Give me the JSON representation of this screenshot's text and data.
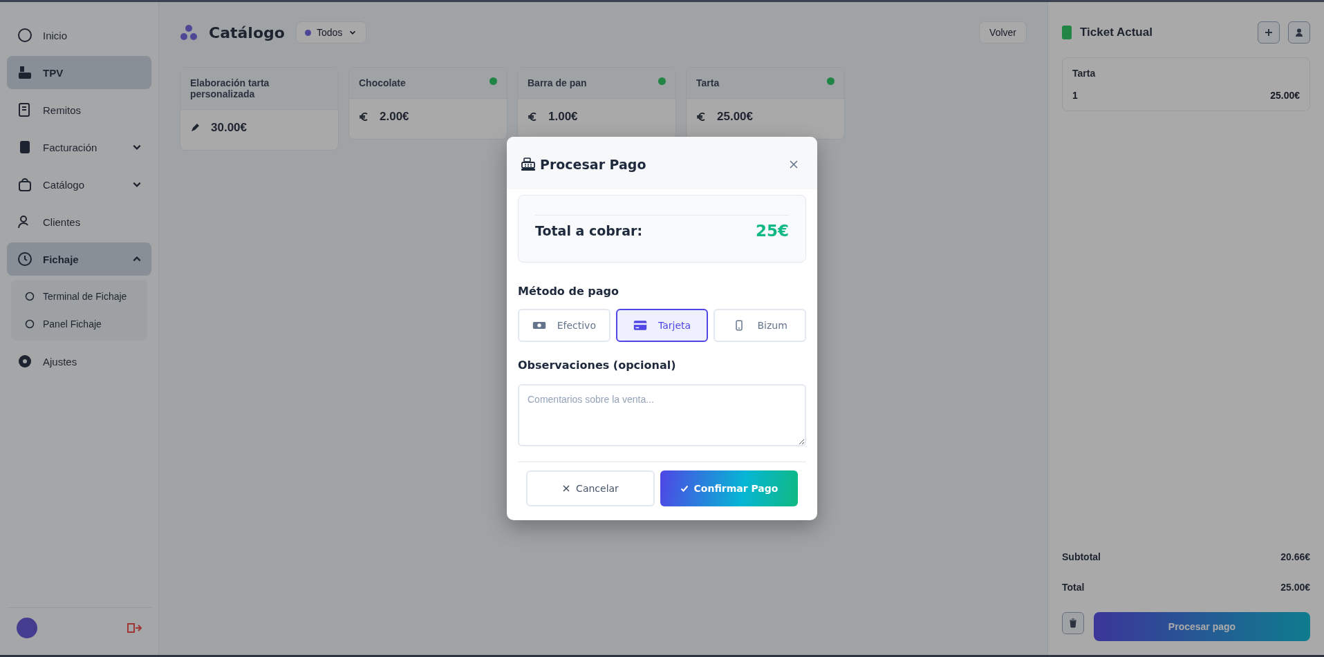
{
  "sidebar": {
    "items": [
      {
        "label": "Inicio",
        "kind": "link",
        "selected": false
      },
      {
        "label": "TPV",
        "kind": "link",
        "selected": true
      },
      {
        "label": "Remitos",
        "kind": "link",
        "selected": false
      },
      {
        "label": "Facturación",
        "kind": "group",
        "expanded": false,
        "selected": false
      },
      {
        "label": "Catálogo",
        "kind": "group",
        "expanded": false,
        "selected": false
      },
      {
        "label": "Clientes",
        "kind": "link",
        "selected": false
      },
      {
        "label": "Fichaje",
        "kind": "group",
        "expanded": true,
        "selected": true,
        "children": [
          {
            "label": "Terminal de Fichaje",
            "selected": false
          },
          {
            "label": "Panel Fichaje",
            "selected": false
          }
        ]
      },
      {
        "label": "Ajustes",
        "kind": "link",
        "selected": false
      }
    ]
  },
  "catalog": {
    "title": "Catálogo",
    "filter": "Todos",
    "back_button": "Volver",
    "products": [
      {
        "name": "Elaboración tarta personalizada",
        "price": "30.00€",
        "kind": "service",
        "available": false
      },
      {
        "name": "Chocolate",
        "price": "2.00€",
        "kind": "product",
        "available": true
      },
      {
        "name": "Barra de pan",
        "price": "1.00€",
        "kind": "product",
        "available": true
      },
      {
        "name": "Tarta",
        "price": "25.00€",
        "kind": "product",
        "available": true
      }
    ]
  },
  "ticket": {
    "title": "Ticket Actual",
    "lines": [
      {
        "name": "Tarta",
        "quantity": "1",
        "amount": "25.00€"
      }
    ],
    "subtotal_label": "Subtotal",
    "subtotal": "20.66€",
    "total_label": "Total",
    "total": "25.00€",
    "pay_button": "Procesar pago"
  },
  "dialog": {
    "title": "Procesar Pago",
    "total_label": "Total a cobrar:",
    "total": "25€",
    "method_label": "Método de pago",
    "methods": [
      {
        "label": "Efectivo",
        "kind": "cash",
        "selected": false
      },
      {
        "label": "Tarjeta",
        "kind": "card",
        "selected": true
      },
      {
        "label": "Bizum",
        "kind": "phone",
        "selected": false
      }
    ],
    "notes_label": "Observaciones (opcional)",
    "notes_placeholder": "Comentarios sobre la venta...",
    "cancel_button": "Cancelar",
    "confirm_button": "Confirmar Pago"
  }
}
